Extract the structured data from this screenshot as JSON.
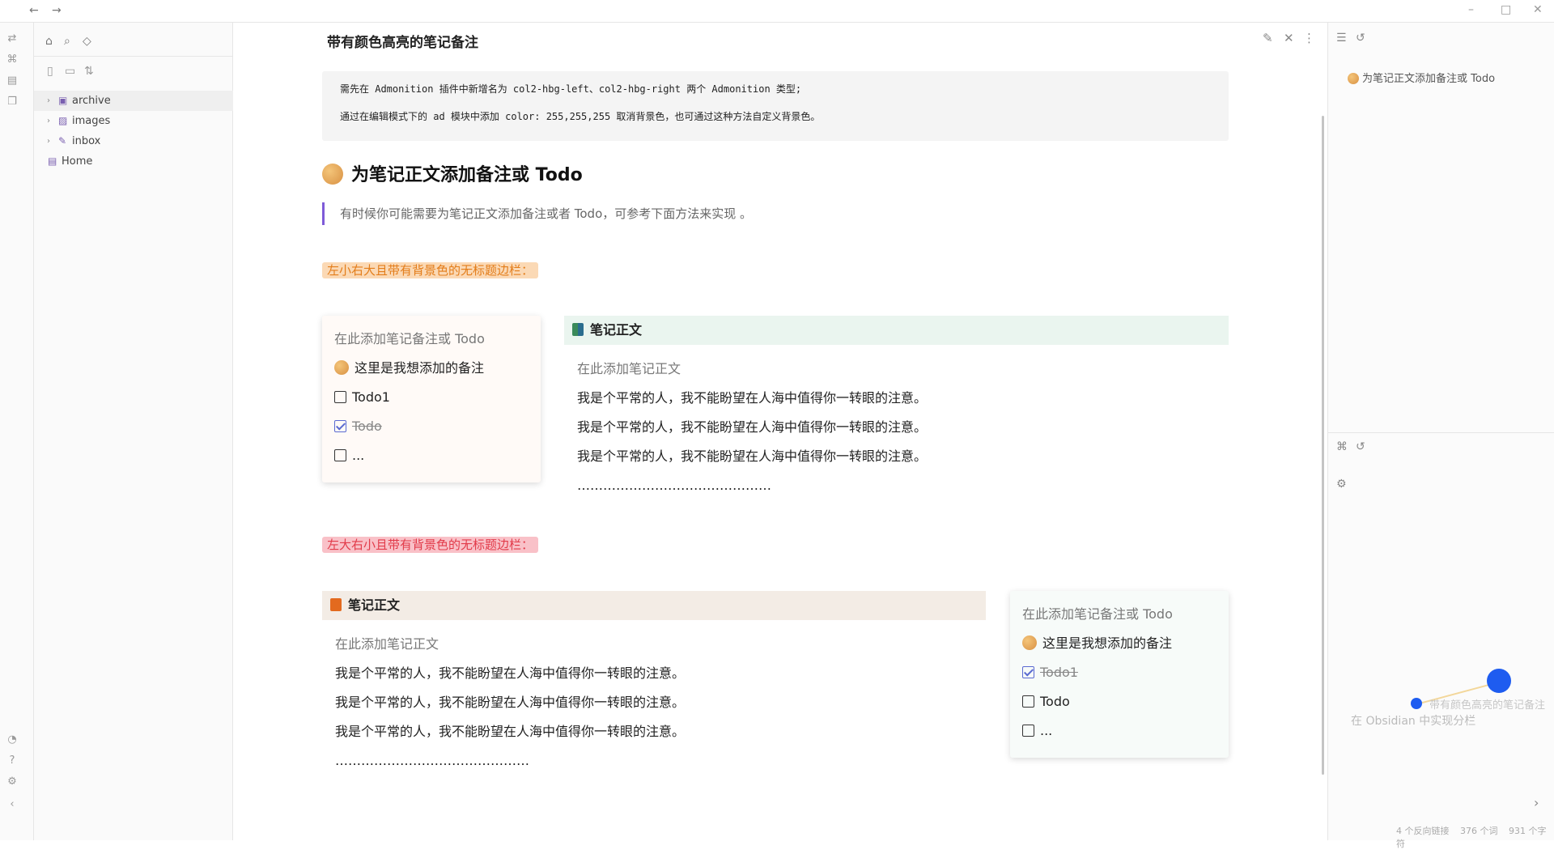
{
  "window": {
    "back": "←",
    "forward": "→",
    "minimize": "–",
    "maximize": "□",
    "close": "✕"
  },
  "file_tree": [
    {
      "label": "archive",
      "type": "folder"
    },
    {
      "label": "images",
      "type": "folder"
    },
    {
      "label": "inbox",
      "type": "folder"
    },
    {
      "label": "Home",
      "type": "file"
    }
  ],
  "note": {
    "title": "带有颜色高亮的笔记备注",
    "callout": {
      "line1": "需先在 Admonition 插件中新增名为 col2-hbg-left、col2-hbg-right 两个 Admonition 类型;",
      "line2": "通过在编辑模式下的 ad 模块中添加 color: 255,255,255 取消背景色，也可通过这种方法自定义背景色。"
    },
    "heading": "为笔记正文添加备注或 Todo",
    "quote": "有时候你可能需要为笔记正文添加备注或者 Todo，可参考下面方法来实现 。",
    "highlight1": "左小右大且带有背景色的无标题边栏：",
    "highlight2": "左大右小且带有背景色的无标题边栏：",
    "layout1": {
      "card": {
        "placeholder": "在此添加笔记备注或 Todo",
        "remark": "这里是我想添加的备注",
        "todos": [
          {
            "label": "Todo1",
            "checked": false
          },
          {
            "label": "Todo",
            "checked": true
          },
          {
            "label": "...",
            "checked": false
          }
        ]
      },
      "body": {
        "header": "笔记正文",
        "placeholder": "在此添加笔记正文",
        "lines": [
          "我是个平常的人，我不能盼望在人海中值得你一转眼的注意。",
          "我是个平常的人，我不能盼望在人海中值得你一转眼的注意。",
          "我是个平常的人，我不能盼望在人海中值得你一转眼的注意。"
        ],
        "dots": "………………………………………"
      }
    },
    "layout2": {
      "body": {
        "header": "笔记正文",
        "placeholder": "在此添加笔记正文",
        "lines": [
          "我是个平常的人，我不能盼望在人海中值得你一转眼的注意。",
          "我是个平常的人，我不能盼望在人海中值得你一转眼的注意。",
          "我是个平常的人，我不能盼望在人海中值得你一转眼的注意。"
        ],
        "dots": "………………………………………"
      },
      "card": {
        "placeholder": "在此添加笔记备注或 Todo",
        "remark": "这里是我想添加的备注",
        "todos": [
          {
            "label": "Todo1",
            "checked": true
          },
          {
            "label": "Todo",
            "checked": false
          },
          {
            "label": "...",
            "checked": false
          }
        ]
      }
    }
  },
  "outline": {
    "item": "为笔记正文添加备注或 Todo"
  },
  "graph": {
    "node_current": "带有颜色高亮的笔记备注",
    "node_linked": "在 Obsidian 中实现分栏"
  },
  "status_bar": {
    "backlinks": "4 个反向链接",
    "words": "376 个词",
    "chars": "931 个字符"
  },
  "colors": {
    "accent": "#7e5bd8",
    "graph_node": "#1e5cf0",
    "orange_highlight": "#e37d1a",
    "red_highlight": "#e23b4a"
  }
}
